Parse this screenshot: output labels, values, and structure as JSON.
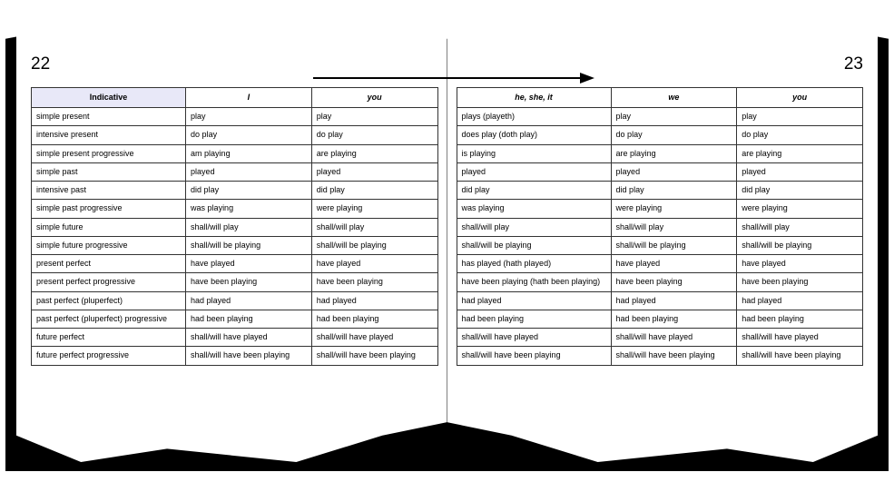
{
  "page_left_num": "22",
  "page_right_num": "23",
  "left_headers": [
    "Indicative",
    "I",
    "you"
  ],
  "right_headers": [
    "he, she, it",
    "we",
    "you"
  ],
  "rows": [
    {
      "tense": "simple present",
      "i": "play",
      "you": "play",
      "he": "plays (playeth)",
      "we": "play",
      "you2": "play"
    },
    {
      "tense": "intensive present",
      "i": "do play",
      "you": "do play",
      "he": "does play (doth play)",
      "we": "do play",
      "you2": "do play"
    },
    {
      "tense": "simple present progressive",
      "i": "am playing",
      "you": "are playing",
      "he": "is playing",
      "we": "are playing",
      "you2": "are playing"
    },
    {
      "tense": "simple past",
      "i": "played",
      "you": "played",
      "he": "played",
      "we": "played",
      "you2": "played"
    },
    {
      "tense": "intensive past",
      "i": "did play",
      "you": "did play",
      "he": "did play",
      "we": "did play",
      "you2": "did play"
    },
    {
      "tense": "simple past progressive",
      "i": "was playing",
      "you": "were playing",
      "he": "was playing",
      "we": "were playing",
      "you2": "were playing"
    },
    {
      "tense": "simple future",
      "i": "shall/will play",
      "you": "shall/will play",
      "he": "shall/will play",
      "we": "shall/will play",
      "you2": "shall/will play"
    },
    {
      "tense": "simple future progressive",
      "i": "shall/will be playing",
      "you": "shall/will be playing",
      "he": "shall/will be playing",
      "we": "shall/will be playing",
      "you2": "shall/will be playing"
    },
    {
      "tense": "present perfect",
      "i": "have played",
      "you": "have played",
      "he": "has played (hath played)",
      "we": "have played",
      "you2": "have played"
    },
    {
      "tense": "present perfect progressive",
      "i": "have been playing",
      "you": "have been playing",
      "he": "have been playing (hath been playing)",
      "we": "have been playing",
      "you2": "have been playing"
    },
    {
      "tense": "past perfect (pluperfect)",
      "i": "had played",
      "you": "had played",
      "he": "had played",
      "we": "had played",
      "you2": "had played"
    },
    {
      "tense": "past perfect (pluperfect) progressive",
      "i": "had been playing",
      "you": "had been playing",
      "he": "had been playing",
      "we": "had been playing",
      "you2": "had been playing"
    },
    {
      "tense": "future perfect",
      "i": "shall/will have played",
      "you": "shall/will have played",
      "he": "shall/will have played",
      "we": "shall/will have played",
      "you2": "shall/will have played"
    },
    {
      "tense": "future perfect progressive",
      "i": "shall/will have been playing",
      "you": "shall/will have been playing",
      "he": "shall/will have been playing",
      "we": "shall/will have been playing",
      "you2": "shall/will have been playing"
    }
  ]
}
